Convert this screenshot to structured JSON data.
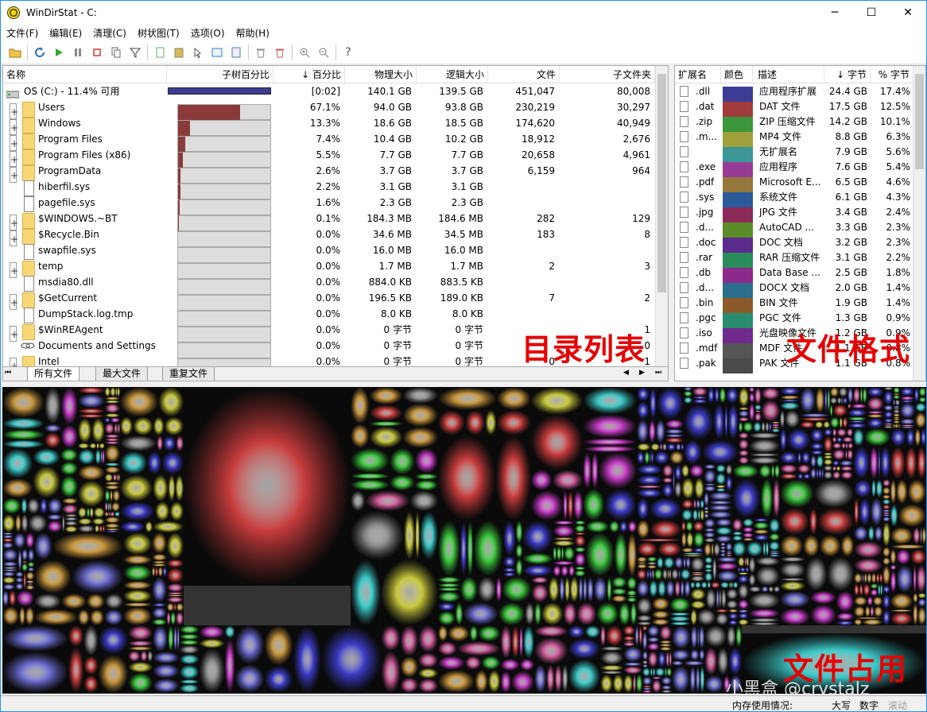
{
  "window": {
    "title": "WinDirStat - C:",
    "minimize": "─",
    "maximize": "☐",
    "close": "✕"
  },
  "menu": [
    "文件(F)",
    "编辑(E)",
    "清理(C)",
    "树状图(T)",
    "选项(O)",
    "帮助(H)"
  ],
  "toolbar": {
    "help": "?"
  },
  "tree": {
    "headers": {
      "name": "名称",
      "subtree_pct": "子树百分比",
      "pct": "↓ 百分比",
      "physical": "物理大小",
      "logical": "逻辑大小",
      "files": "文件",
      "subfolders": "子文件夹"
    },
    "root": {
      "name": "OS (C:) - 11.4% 可用",
      "pct": "[0:02]",
      "physical": "140.1 GB",
      "logical": "139.5 GB",
      "files": "451,047",
      "subfolders": "80,008"
    },
    "rows": [
      {
        "name": "Users",
        "kind": "folder",
        "bar": 0.671,
        "pct": "67.1%",
        "physical": "94.0 GB",
        "logical": "93.8 GB",
        "files": "230,219",
        "subfolders": "30,297"
      },
      {
        "name": "Windows",
        "kind": "folder",
        "bar": 0.133,
        "pct": "13.3%",
        "physical": "18.6 GB",
        "logical": "18.5 GB",
        "files": "174,620",
        "subfolders": "40,949"
      },
      {
        "name": "Program Files",
        "kind": "folder",
        "bar": 0.074,
        "pct": "7.4%",
        "physical": "10.4 GB",
        "logical": "10.2 GB",
        "files": "18,912",
        "subfolders": "2,676"
      },
      {
        "name": "Program Files (x86)",
        "kind": "folder",
        "bar": 0.055,
        "pct": "5.5%",
        "physical": "7.7 GB",
        "logical": "7.7 GB",
        "files": "20,658",
        "subfolders": "4,961"
      },
      {
        "name": "ProgramData",
        "kind": "folder",
        "bar": 0.026,
        "pct": "2.6%",
        "physical": "3.7 GB",
        "logical": "3.7 GB",
        "files": "6,159",
        "subfolders": "964"
      },
      {
        "name": "hiberfil.sys",
        "kind": "file",
        "bar": 0.022,
        "pct": "2.2%",
        "physical": "3.1 GB",
        "logical": "3.1 GB",
        "files": "",
        "subfolders": ""
      },
      {
        "name": "pagefile.sys",
        "kind": "file",
        "bar": 0.016,
        "pct": "1.6%",
        "physical": "2.3 GB",
        "logical": "2.3 GB",
        "files": "",
        "subfolders": ""
      },
      {
        "name": "$WINDOWS.~BT",
        "kind": "folder",
        "bar": 0.001,
        "pct": "0.1%",
        "physical": "184.3 MB",
        "logical": "184.6 MB",
        "files": "282",
        "subfolders": "129"
      },
      {
        "name": "$Recycle.Bin",
        "kind": "folder",
        "bar": 0,
        "pct": "0.0%",
        "physical": "34.6 MB",
        "logical": "34.5 MB",
        "files": "183",
        "subfolders": "8"
      },
      {
        "name": "swapfile.sys",
        "kind": "file",
        "bar": 0,
        "pct": "0.0%",
        "physical": "16.0 MB",
        "logical": "16.0 MB",
        "files": "",
        "subfolders": ""
      },
      {
        "name": "temp",
        "kind": "folder",
        "bar": 0,
        "pct": "0.0%",
        "physical": "1.7 MB",
        "logical": "1.7 MB",
        "files": "2",
        "subfolders": "3"
      },
      {
        "name": "msdia80.dll",
        "kind": "file",
        "bar": 0,
        "pct": "0.0%",
        "physical": "884.0 KB",
        "logical": "883.5 KB",
        "files": "",
        "subfolders": ""
      },
      {
        "name": "$GetCurrent",
        "kind": "folder",
        "bar": 0,
        "pct": "0.0%",
        "physical": "196.5 KB",
        "logical": "189.0 KB",
        "files": "7",
        "subfolders": "2"
      },
      {
        "name": "DumpStack.log.tmp",
        "kind": "file",
        "bar": 0,
        "pct": "0.0%",
        "physical": "8.0 KB",
        "logical": "8.0 KB",
        "files": "",
        "subfolders": ""
      },
      {
        "name": "$WinREAgent",
        "kind": "folder",
        "bar": 0,
        "pct": "0.0%",
        "physical": "0 字节",
        "logical": "0 字节",
        "files": "",
        "subfolders": "1"
      },
      {
        "name": "Documents and Settings",
        "kind": "link",
        "bar": 0,
        "pct": "0.0%",
        "physical": "0 字节",
        "logical": "0 字节",
        "files": "",
        "subfolders": "0"
      },
      {
        "name": "Intel",
        "kind": "folder",
        "bar": 0,
        "pct": "0.0%",
        "physical": "0 字节",
        "logical": "0 字节",
        "files": "0",
        "subfolders": "1"
      }
    ],
    "tabs": [
      "所有文件",
      "最大文件",
      "重复文件"
    ]
  },
  "ext": {
    "headers": {
      "ext": "扩展名",
      "color": "颜色",
      "desc": "描述",
      "bytes": "↓ 字节",
      "pct": "% 字节"
    },
    "rows": [
      {
        "ext": ".dll",
        "color": "#3c3c96",
        "desc": "应用程序扩展",
        "bytes": "24.4 GB",
        "pct": "17.4%"
      },
      {
        "ext": ".dat",
        "color": "#a03c3c",
        "desc": "DAT 文件",
        "bytes": "17.5 GB",
        "pct": "12.5%"
      },
      {
        "ext": ".zip",
        "color": "#3c963c",
        "desc": "ZIP 压缩文件",
        "bytes": "14.2 GB",
        "pct": "10.1%"
      },
      {
        "ext": ".m...",
        "color": "#a0a03c",
        "desc": "MP4 文件",
        "bytes": "8.8 GB",
        "pct": "6.3%"
      },
      {
        "ext": "",
        "color": "#3c9696",
        "desc": "无扩展名",
        "bytes": "7.9 GB",
        "pct": "5.6%"
      },
      {
        "ext": ".exe",
        "color": "#963c96",
        "desc": "应用程序",
        "bytes": "7.6 GB",
        "pct": "5.4%"
      },
      {
        "ext": ".pdf",
        "color": "#96783c",
        "desc": "Microsoft E...",
        "bytes": "6.5 GB",
        "pct": "4.6%"
      },
      {
        "ext": ".sys",
        "color": "#2a5a9a",
        "desc": "系统文件",
        "bytes": "6.1 GB",
        "pct": "4.3%"
      },
      {
        "ext": ".jpg",
        "color": "#8c2a5a",
        "desc": "JPG 文件",
        "bytes": "3.4 GB",
        "pct": "2.4%"
      },
      {
        "ext": ".d...",
        "color": "#5a8c2a",
        "desc": "AutoCAD ...",
        "bytes": "3.3 GB",
        "pct": "2.3%"
      },
      {
        "ext": ".doc",
        "color": "#5a2a8c",
        "desc": "DOC 文档",
        "bytes": "3.2 GB",
        "pct": "2.3%"
      },
      {
        "ext": ".rar",
        "color": "#2a8c5a",
        "desc": "RAR 压缩文件",
        "bytes": "3.1 GB",
        "pct": "2.2%"
      },
      {
        "ext": ".db",
        "color": "#8c2a8c",
        "desc": "Data Base ...",
        "bytes": "2.5 GB",
        "pct": "1.8%"
      },
      {
        "ext": ".d...",
        "color": "#2a6e8c",
        "desc": "DOCX 文档",
        "bytes": "2.0 GB",
        "pct": "1.4%"
      },
      {
        "ext": ".bin",
        "color": "#8c5a2a",
        "desc": "BIN 文件",
        "bytes": "1.9 GB",
        "pct": "1.4%"
      },
      {
        "ext": ".pgc",
        "color": "#2a8c6e",
        "desc": "PGC 文件",
        "bytes": "1.3 GB",
        "pct": "0.9%"
      },
      {
        "ext": ".iso",
        "color": "#6e2a8c",
        "desc": "光盘映像文件",
        "bytes": "1.2 GB",
        "pct": "0.9%"
      },
      {
        "ext": ".mdf",
        "color": "#555555",
        "desc": "MDF 文件",
        "bytes": "1.1 GB",
        "pct": "0.8%"
      },
      {
        "ext": ".pak",
        "color": "#4a4a4a",
        "desc": "PAK 文件",
        "bytes": "1.1 GB",
        "pct": "0.8%"
      }
    ]
  },
  "annotations": {
    "dir_list": "目录列表",
    "file_format": "文件格式",
    "file_usage": "文件占用"
  },
  "watermark": "小黑盒 @crystalz",
  "status": {
    "memory": "内存使用情况:",
    "caps": "大写",
    "num": "数字",
    "scroll": "滚动"
  }
}
